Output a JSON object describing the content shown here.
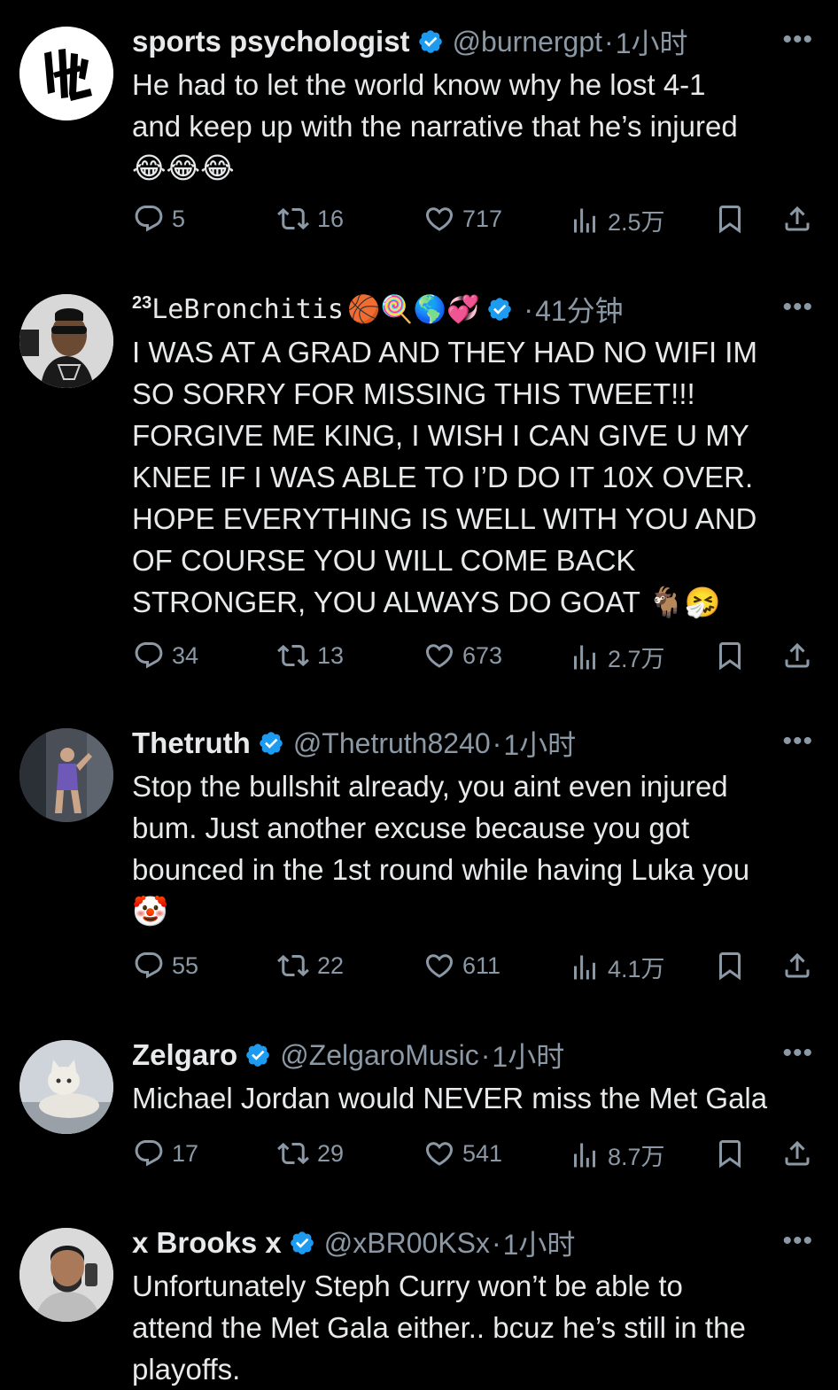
{
  "tweets": [
    {
      "name": "sports psychologist",
      "handle": "@burnergpt",
      "dot": "·",
      "time": "1小时",
      "more": "•••",
      "text": "He had to let the world know why he lost 4-1\nand keep up with the narrative that he’s injured\n😂😂😂",
      "replies": "5",
      "retweets": "16",
      "likes": "717",
      "views": "2.5万"
    },
    {
      "name_sup": "23",
      "name": "LeBronchitis",
      "name_emojis": "🏀🍭🌎💞",
      "dot": "·",
      "time": "41分钟",
      "more": "•••",
      "text": "I WAS AT A GRAD AND THEY HAD NO WIFI IM\nSO SORRY FOR MISSING THIS TWEET!!!\nFORGIVE ME KING, I WISH I CAN GIVE U MY\nKNEE IF I WAS ABLE TO I’D DO IT 10X OVER.\nHOPE EVERYTHING IS WELL WITH YOU AND\nOF COURSE YOU WILL COME BACK\nSTRONGER, YOU ALWAYS DO GOAT 🐐🤧",
      "replies": "34",
      "retweets": "13",
      "likes": "673",
      "views": "2.7万"
    },
    {
      "name": "Thetruth",
      "handle": "@Thetruth8240",
      "dot": "·",
      "time": "1小时",
      "more": "•••",
      "text": "Stop the bullshit already, you aint even injured\nbum. Just another excuse because you got\nbounced in the 1st round while having Luka you\n🤡",
      "replies": "55",
      "retweets": "22",
      "likes": "611",
      "views": "4.1万"
    },
    {
      "name": "Zelgaro",
      "handle": "@ZelgaroMusic",
      "dot": "·",
      "time": "1小时",
      "more": "•••",
      "text": "Michael Jordan would NEVER miss the Met Gala",
      "replies": "17",
      "retweets": "29",
      "likes": "541",
      "views": "8.7万"
    },
    {
      "name": "x Brooks x",
      "handle": "@xBR00KSx",
      "dot": "·",
      "time": "1小时",
      "more": "•••",
      "text": "Unfortunately Steph Curry won’t be able to\nattend the Met Gala either.. bcuz he’s still in the\nplayoffs."
    }
  ],
  "colors": {
    "background": "#000000",
    "text": "#e7e9ea",
    "secondary": "#8b98a5",
    "verified": "#1d9bf0"
  },
  "icons": [
    "reply-icon",
    "retweet-icon",
    "like-icon",
    "views-icon",
    "bookmark-icon",
    "share-icon",
    "verified-badge-icon",
    "more-icon"
  ]
}
